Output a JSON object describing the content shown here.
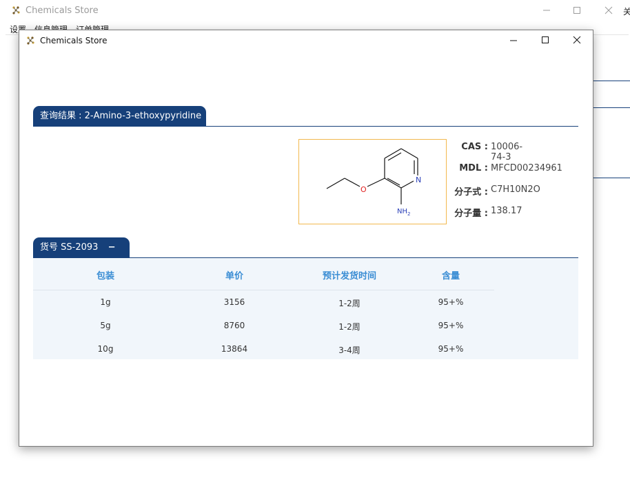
{
  "background_window": {
    "title": "Chemicals Store",
    "menu": [
      "设置",
      "信息管理",
      "订单管理"
    ],
    "right_text": "关"
  },
  "dialog": {
    "title": "Chemicals Store",
    "result_header": "查询结果 : 2-Amino-3-ethoxypyridine",
    "structure": {
      "atom_o": "O",
      "atom_n": "N",
      "atom_nh": "NH",
      "atom_nh_sub": "2"
    },
    "properties": [
      {
        "label": "CAS :",
        "value": "10006-74-3"
      },
      {
        "label": "MDL :",
        "value": "MFCD00234961"
      },
      {
        "label": "分子式 :",
        "value": "C7H10N2O"
      },
      {
        "label": "分子量 :",
        "value": "138.17"
      }
    ],
    "product": {
      "header": "货号 SS-2093",
      "toggle": "−"
    },
    "table": {
      "columns": [
        "包装",
        "单价",
        "预计发货时间",
        "含量"
      ],
      "rows": [
        [
          "1g",
          "3156",
          "1-2周",
          "95+%"
        ],
        [
          "5g",
          "8760",
          "1-2周",
          "95+%"
        ],
        [
          "10g",
          "13864",
          "3-4周",
          "95+%"
        ]
      ]
    }
  }
}
